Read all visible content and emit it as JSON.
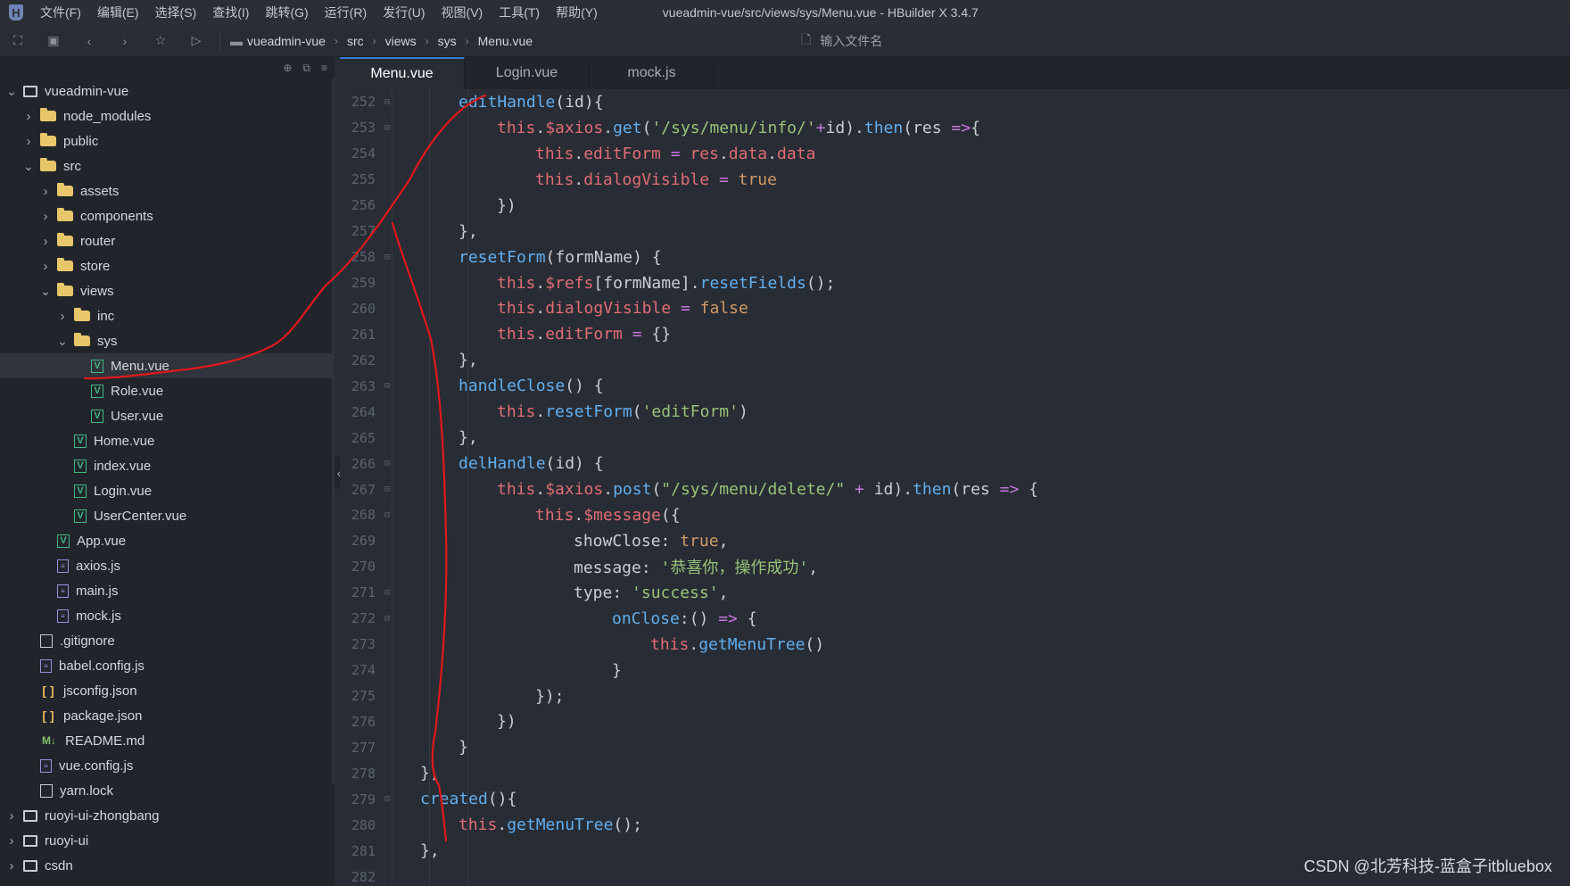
{
  "menubar": {
    "items": [
      "文件(F)",
      "编辑(E)",
      "选择(S)",
      "查找(I)",
      "跳转(G)",
      "运行(R)",
      "发行(U)",
      "视图(V)",
      "工具(T)",
      "帮助(Y)"
    ],
    "window_title": "vueadmin-vue/src/views/sys/Menu.vue - HBuilder X 3.4.7"
  },
  "toolbar": {
    "breadcrumb": [
      "vueadmin-vue",
      "src",
      "views",
      "sys",
      "Menu.vue"
    ],
    "file_search_placeholder": "输入文件名"
  },
  "sidebar": {
    "tree": [
      {
        "label": "vueadmin-vue",
        "depth": 0,
        "icon": "project",
        "arrow": "down"
      },
      {
        "label": "node_modules",
        "depth": 1,
        "icon": "folder",
        "arrow": "right"
      },
      {
        "label": "public",
        "depth": 1,
        "icon": "folder",
        "arrow": "right"
      },
      {
        "label": "src",
        "depth": 1,
        "icon": "folder-open",
        "arrow": "down"
      },
      {
        "label": "assets",
        "depth": 2,
        "icon": "folder",
        "arrow": "right"
      },
      {
        "label": "components",
        "depth": 2,
        "icon": "folder",
        "arrow": "right"
      },
      {
        "label": "router",
        "depth": 2,
        "icon": "folder",
        "arrow": "right"
      },
      {
        "label": "store",
        "depth": 2,
        "icon": "folder",
        "arrow": "right"
      },
      {
        "label": "views",
        "depth": 2,
        "icon": "folder-open",
        "arrow": "down"
      },
      {
        "label": "inc",
        "depth": 3,
        "icon": "folder",
        "arrow": "right"
      },
      {
        "label": "sys",
        "depth": 3,
        "icon": "folder-open",
        "arrow": "down"
      },
      {
        "label": "Menu.vue",
        "depth": 4,
        "icon": "vue",
        "arrow": "none",
        "selected": true
      },
      {
        "label": "Role.vue",
        "depth": 4,
        "icon": "vue",
        "arrow": "none"
      },
      {
        "label": "User.vue",
        "depth": 4,
        "icon": "vue",
        "arrow": "none"
      },
      {
        "label": "Home.vue",
        "depth": 3,
        "icon": "vue",
        "arrow": "none"
      },
      {
        "label": "index.vue",
        "depth": 3,
        "icon": "vue",
        "arrow": "none"
      },
      {
        "label": "Login.vue",
        "depth": 3,
        "icon": "vue",
        "arrow": "none"
      },
      {
        "label": "UserCenter.vue",
        "depth": 3,
        "icon": "vue",
        "arrow": "none"
      },
      {
        "label": "App.vue",
        "depth": 2,
        "icon": "vue",
        "arrow": "none"
      },
      {
        "label": "axios.js",
        "depth": 2,
        "icon": "js",
        "arrow": "none"
      },
      {
        "label": "main.js",
        "depth": 2,
        "icon": "js",
        "arrow": "none"
      },
      {
        "label": "mock.js",
        "depth": 2,
        "icon": "js",
        "arrow": "none"
      },
      {
        "label": ".gitignore",
        "depth": 1,
        "icon": "plain",
        "arrow": "none"
      },
      {
        "label": "babel.config.js",
        "depth": 1,
        "icon": "js",
        "arrow": "none"
      },
      {
        "label": "jsconfig.json",
        "depth": 1,
        "icon": "json",
        "arrow": "none"
      },
      {
        "label": "package.json",
        "depth": 1,
        "icon": "json",
        "arrow": "none"
      },
      {
        "label": "README.md",
        "depth": 1,
        "icon": "md",
        "arrow": "none"
      },
      {
        "label": "vue.config.js",
        "depth": 1,
        "icon": "js",
        "arrow": "none"
      },
      {
        "label": "yarn.lock",
        "depth": 1,
        "icon": "plain",
        "arrow": "none"
      },
      {
        "label": "ruoyi-ui-zhongbang",
        "depth": 0,
        "icon": "project",
        "arrow": "right"
      },
      {
        "label": "ruoyi-ui",
        "depth": 0,
        "icon": "project",
        "arrow": "right"
      },
      {
        "label": "csdn",
        "depth": 0,
        "icon": "project",
        "arrow": "right"
      }
    ]
  },
  "editor": {
    "tabs": [
      {
        "label": "Menu.vue",
        "active": true
      },
      {
        "label": "Login.vue",
        "active": false
      },
      {
        "label": "mock.js",
        "active": false
      }
    ],
    "lines": [
      {
        "n": "252",
        "fold": true,
        "indent": 3,
        "tokens": [
          [
            "f",
            "editHandle"
          ],
          [
            "o",
            "(id){"
          ]
        ]
      },
      {
        "n": "253",
        "fold": true,
        "indent": 4,
        "tokens": [
          [
            "k",
            "this"
          ],
          [
            "o",
            "."
          ],
          [
            "k",
            "$axios"
          ],
          [
            "o",
            "."
          ],
          [
            "f",
            "get"
          ],
          [
            "o",
            "("
          ],
          [
            "s",
            "'/sys/menu/info/'"
          ],
          [
            "p",
            "+"
          ],
          [
            "o",
            "id)."
          ],
          [
            "f",
            "then"
          ],
          [
            "o",
            "(res "
          ],
          [
            "p",
            "=>"
          ],
          [
            "o",
            "{"
          ]
        ]
      },
      {
        "n": "254",
        "fold": false,
        "indent": 5,
        "tokens": [
          [
            "k",
            "this"
          ],
          [
            "o",
            "."
          ],
          [
            "k",
            "editForm"
          ],
          [
            "o",
            " "
          ],
          [
            "p",
            "="
          ],
          [
            "o",
            " "
          ],
          [
            "k",
            "res"
          ],
          [
            "o",
            "."
          ],
          [
            "k",
            "data"
          ],
          [
            "o",
            "."
          ],
          [
            "k",
            "data"
          ]
        ]
      },
      {
        "n": "255",
        "fold": false,
        "indent": 5,
        "tokens": [
          [
            "k",
            "this"
          ],
          [
            "o",
            "."
          ],
          [
            "k",
            "dialogVisible"
          ],
          [
            "o",
            " "
          ],
          [
            "p",
            "="
          ],
          [
            "o",
            " "
          ],
          [
            "b",
            "true"
          ]
        ]
      },
      {
        "n": "256",
        "fold": false,
        "indent": 4,
        "tokens": [
          [
            "o",
            "})"
          ]
        ]
      },
      {
        "n": "257",
        "fold": false,
        "indent": 3,
        "tokens": [
          [
            "o",
            "},"
          ]
        ]
      },
      {
        "n": "258",
        "fold": true,
        "indent": 3,
        "tokens": [
          [
            "f",
            "resetForm"
          ],
          [
            "o",
            "(formName) {"
          ]
        ]
      },
      {
        "n": "259",
        "fold": false,
        "indent": 4,
        "tokens": [
          [
            "k",
            "this"
          ],
          [
            "o",
            "."
          ],
          [
            "k",
            "$refs"
          ],
          [
            "o",
            "[formName]."
          ],
          [
            "f",
            "resetFields"
          ],
          [
            "o",
            "();"
          ]
        ]
      },
      {
        "n": "260",
        "fold": false,
        "indent": 4,
        "tokens": [
          [
            "k",
            "this"
          ],
          [
            "o",
            "."
          ],
          [
            "k",
            "dialogVisible"
          ],
          [
            "o",
            " "
          ],
          [
            "p",
            "="
          ],
          [
            "o",
            " "
          ],
          [
            "b",
            "false"
          ]
        ]
      },
      {
        "n": "261",
        "fold": false,
        "indent": 4,
        "tokens": [
          [
            "k",
            "this"
          ],
          [
            "o",
            "."
          ],
          [
            "k",
            "editForm"
          ],
          [
            "o",
            " "
          ],
          [
            "p",
            "="
          ],
          [
            "o",
            " {}"
          ]
        ]
      },
      {
        "n": "262",
        "fold": false,
        "indent": 3,
        "tokens": [
          [
            "o",
            "},"
          ]
        ]
      },
      {
        "n": "263",
        "fold": true,
        "indent": 3,
        "tokens": [
          [
            "f",
            "handleClose"
          ],
          [
            "o",
            "() {"
          ]
        ]
      },
      {
        "n": "264",
        "fold": false,
        "indent": 4,
        "tokens": [
          [
            "k",
            "this"
          ],
          [
            "o",
            "."
          ],
          [
            "f",
            "resetForm"
          ],
          [
            "o",
            "("
          ],
          [
            "s",
            "'editForm'"
          ],
          [
            "o",
            ")"
          ]
        ]
      },
      {
        "n": "265",
        "fold": false,
        "indent": 3,
        "tokens": [
          [
            "o",
            "},"
          ]
        ]
      },
      {
        "n": "266",
        "fold": true,
        "indent": 3,
        "tokens": [
          [
            "f",
            "delHandle"
          ],
          [
            "o",
            "(id) {"
          ]
        ]
      },
      {
        "n": "267",
        "fold": true,
        "indent": 4,
        "tokens": [
          [
            "k",
            "this"
          ],
          [
            "o",
            "."
          ],
          [
            "k",
            "$axios"
          ],
          [
            "o",
            "."
          ],
          [
            "f",
            "post"
          ],
          [
            "o",
            "("
          ],
          [
            "s",
            "\"/sys/menu/delete/\""
          ],
          [
            "o",
            " "
          ],
          [
            "p",
            "+"
          ],
          [
            "o",
            " id)."
          ],
          [
            "f",
            "then"
          ],
          [
            "o",
            "(res "
          ],
          [
            "p",
            "=>"
          ],
          [
            "o",
            " {"
          ]
        ]
      },
      {
        "n": "268",
        "fold": true,
        "indent": 5,
        "tokens": [
          [
            "k",
            "this"
          ],
          [
            "o",
            "."
          ],
          [
            "k",
            "$message"
          ],
          [
            "o",
            "({"
          ]
        ]
      },
      {
        "n": "269",
        "fold": false,
        "indent": 6,
        "tokens": [
          [
            "o",
            "showClose: "
          ],
          [
            "b",
            "true"
          ],
          [
            "o",
            ","
          ]
        ]
      },
      {
        "n": "270",
        "fold": false,
        "indent": 6,
        "tokens": [
          [
            "o",
            "message: "
          ],
          [
            "s",
            "'恭喜你，操作成功'"
          ],
          [
            "o",
            ","
          ]
        ]
      },
      {
        "n": "271",
        "fold": true,
        "indent": 6,
        "tokens": [
          [
            "o",
            "type: "
          ],
          [
            "s",
            "'success'"
          ],
          [
            "o",
            ","
          ]
        ]
      },
      {
        "n": "272",
        "fold": true,
        "indent": 7,
        "tokens": [
          [
            "f",
            "onClose"
          ],
          [
            "o",
            ":() "
          ],
          [
            "p",
            "=>"
          ],
          [
            "o",
            " {"
          ]
        ]
      },
      {
        "n": "273",
        "fold": false,
        "indent": 8,
        "tokens": [
          [
            "k",
            "this"
          ],
          [
            "o",
            "."
          ],
          [
            "f",
            "getMenuTree"
          ],
          [
            "o",
            "()"
          ]
        ]
      },
      {
        "n": "274",
        "fold": false,
        "indent": 7,
        "tokens": [
          [
            "o",
            "}"
          ]
        ]
      },
      {
        "n": "275",
        "fold": false,
        "indent": 5,
        "tokens": [
          [
            "o",
            "});"
          ]
        ]
      },
      {
        "n": "276",
        "fold": false,
        "indent": 4,
        "tokens": [
          [
            "o",
            "})"
          ]
        ]
      },
      {
        "n": "277",
        "fold": false,
        "indent": 3,
        "tokens": [
          [
            "o",
            "}"
          ]
        ]
      },
      {
        "n": "278",
        "fold": false,
        "indent": 2,
        "tokens": [
          [
            "o",
            "},"
          ]
        ]
      },
      {
        "n": "279",
        "fold": true,
        "indent": 2,
        "tokens": [
          [
            "f",
            "created"
          ],
          [
            "o",
            "(){"
          ]
        ]
      },
      {
        "n": "280",
        "fold": false,
        "indent": 3,
        "tokens": [
          [
            "k",
            "this"
          ],
          [
            "o",
            "."
          ],
          [
            "f",
            "getMenuTree"
          ],
          [
            "o",
            "();"
          ]
        ]
      },
      {
        "n": "281",
        "fold": false,
        "indent": 2,
        "tokens": [
          [
            "o",
            "},"
          ]
        ]
      },
      {
        "n": "282",
        "fold": false,
        "indent": 2,
        "tokens": []
      }
    ]
  },
  "watermark": "CSDN @北芳科技-蓝盒子itbluebox",
  "colors": {
    "annotation_red": "#e0181c",
    "selected_row": "#30343c",
    "editor_bg": "#282c34",
    "sidebar_bg": "#21252b",
    "tab_active_accent": "#3a7bd5"
  }
}
